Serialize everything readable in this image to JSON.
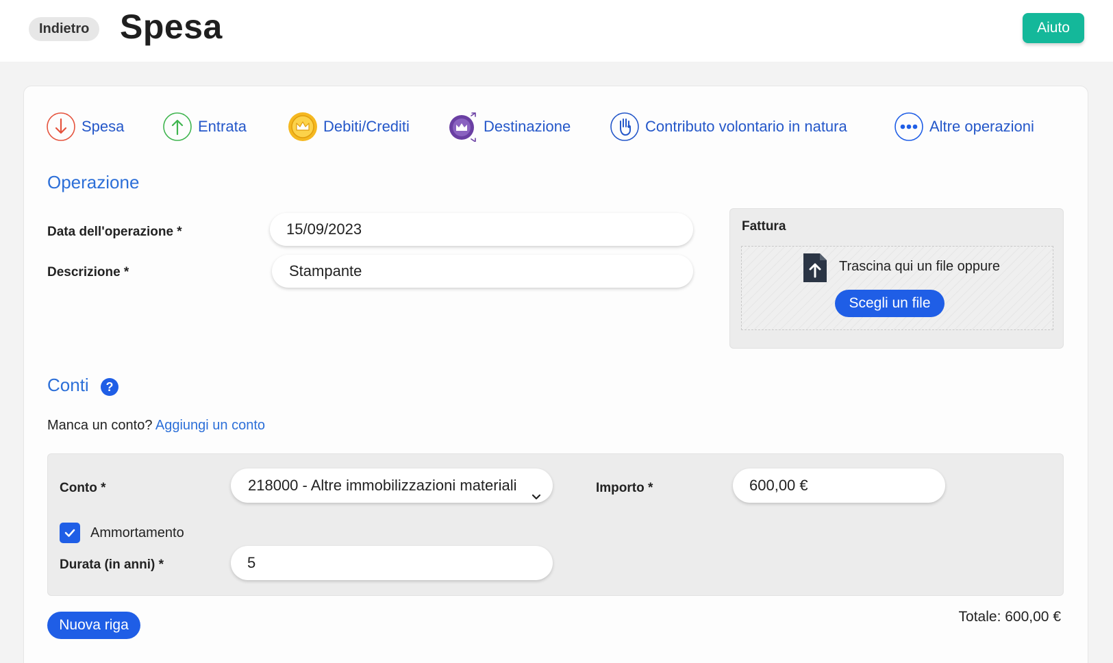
{
  "header": {
    "back_label": "Indietro",
    "title": "Spesa",
    "help_label": "Aiuto",
    "help_color": "#14b89a"
  },
  "operation_types": [
    {
      "label": "Spesa",
      "icon": "arrow-down-icon",
      "color": "#e5533d"
    },
    {
      "label": "Entrata",
      "icon": "arrow-up-icon",
      "color": "#3fb54f"
    },
    {
      "label": "Debiti/Crediti",
      "icon": "crown-coin-icon",
      "color": "#f5b820"
    },
    {
      "label": "Destinazione",
      "icon": "crown-transfer-icon",
      "color": "#6a3fa3"
    },
    {
      "label": "Contributo volontario in natura",
      "icon": "hand-icon",
      "color": "#2457c9"
    },
    {
      "label": "Altre operazioni",
      "icon": "more-icon",
      "color": "#1f5ee6"
    }
  ],
  "operation": {
    "section_title": "Operazione",
    "date_label": "Data dell'operazione *",
    "date_value": "15/09/2023",
    "description_label": "Descrizione *",
    "description_value": "Stampante"
  },
  "invoice": {
    "title": "Fattura",
    "drop_text": "Trascina qui un file oppure",
    "choose_label": "Scegli un file"
  },
  "accounts": {
    "section_title": "Conti",
    "help_symbol": "?",
    "missing_text": "Manca un conto?",
    "add_link": "Aggiungi un conto",
    "row": {
      "account_label": "Conto *",
      "account_value": "218000 -  Altre immobilizzazioni materiali",
      "amount_label": "Importo *",
      "amount_value": "600,00 €",
      "depreciation_label": "Ammortamento",
      "depreciation_checked": true,
      "duration_label": "Durata (in anni) *",
      "duration_value": "5"
    },
    "new_row_label": "Nuova riga",
    "total": "Totale: 600,00 €"
  },
  "accent_color": "#1f5ee6"
}
